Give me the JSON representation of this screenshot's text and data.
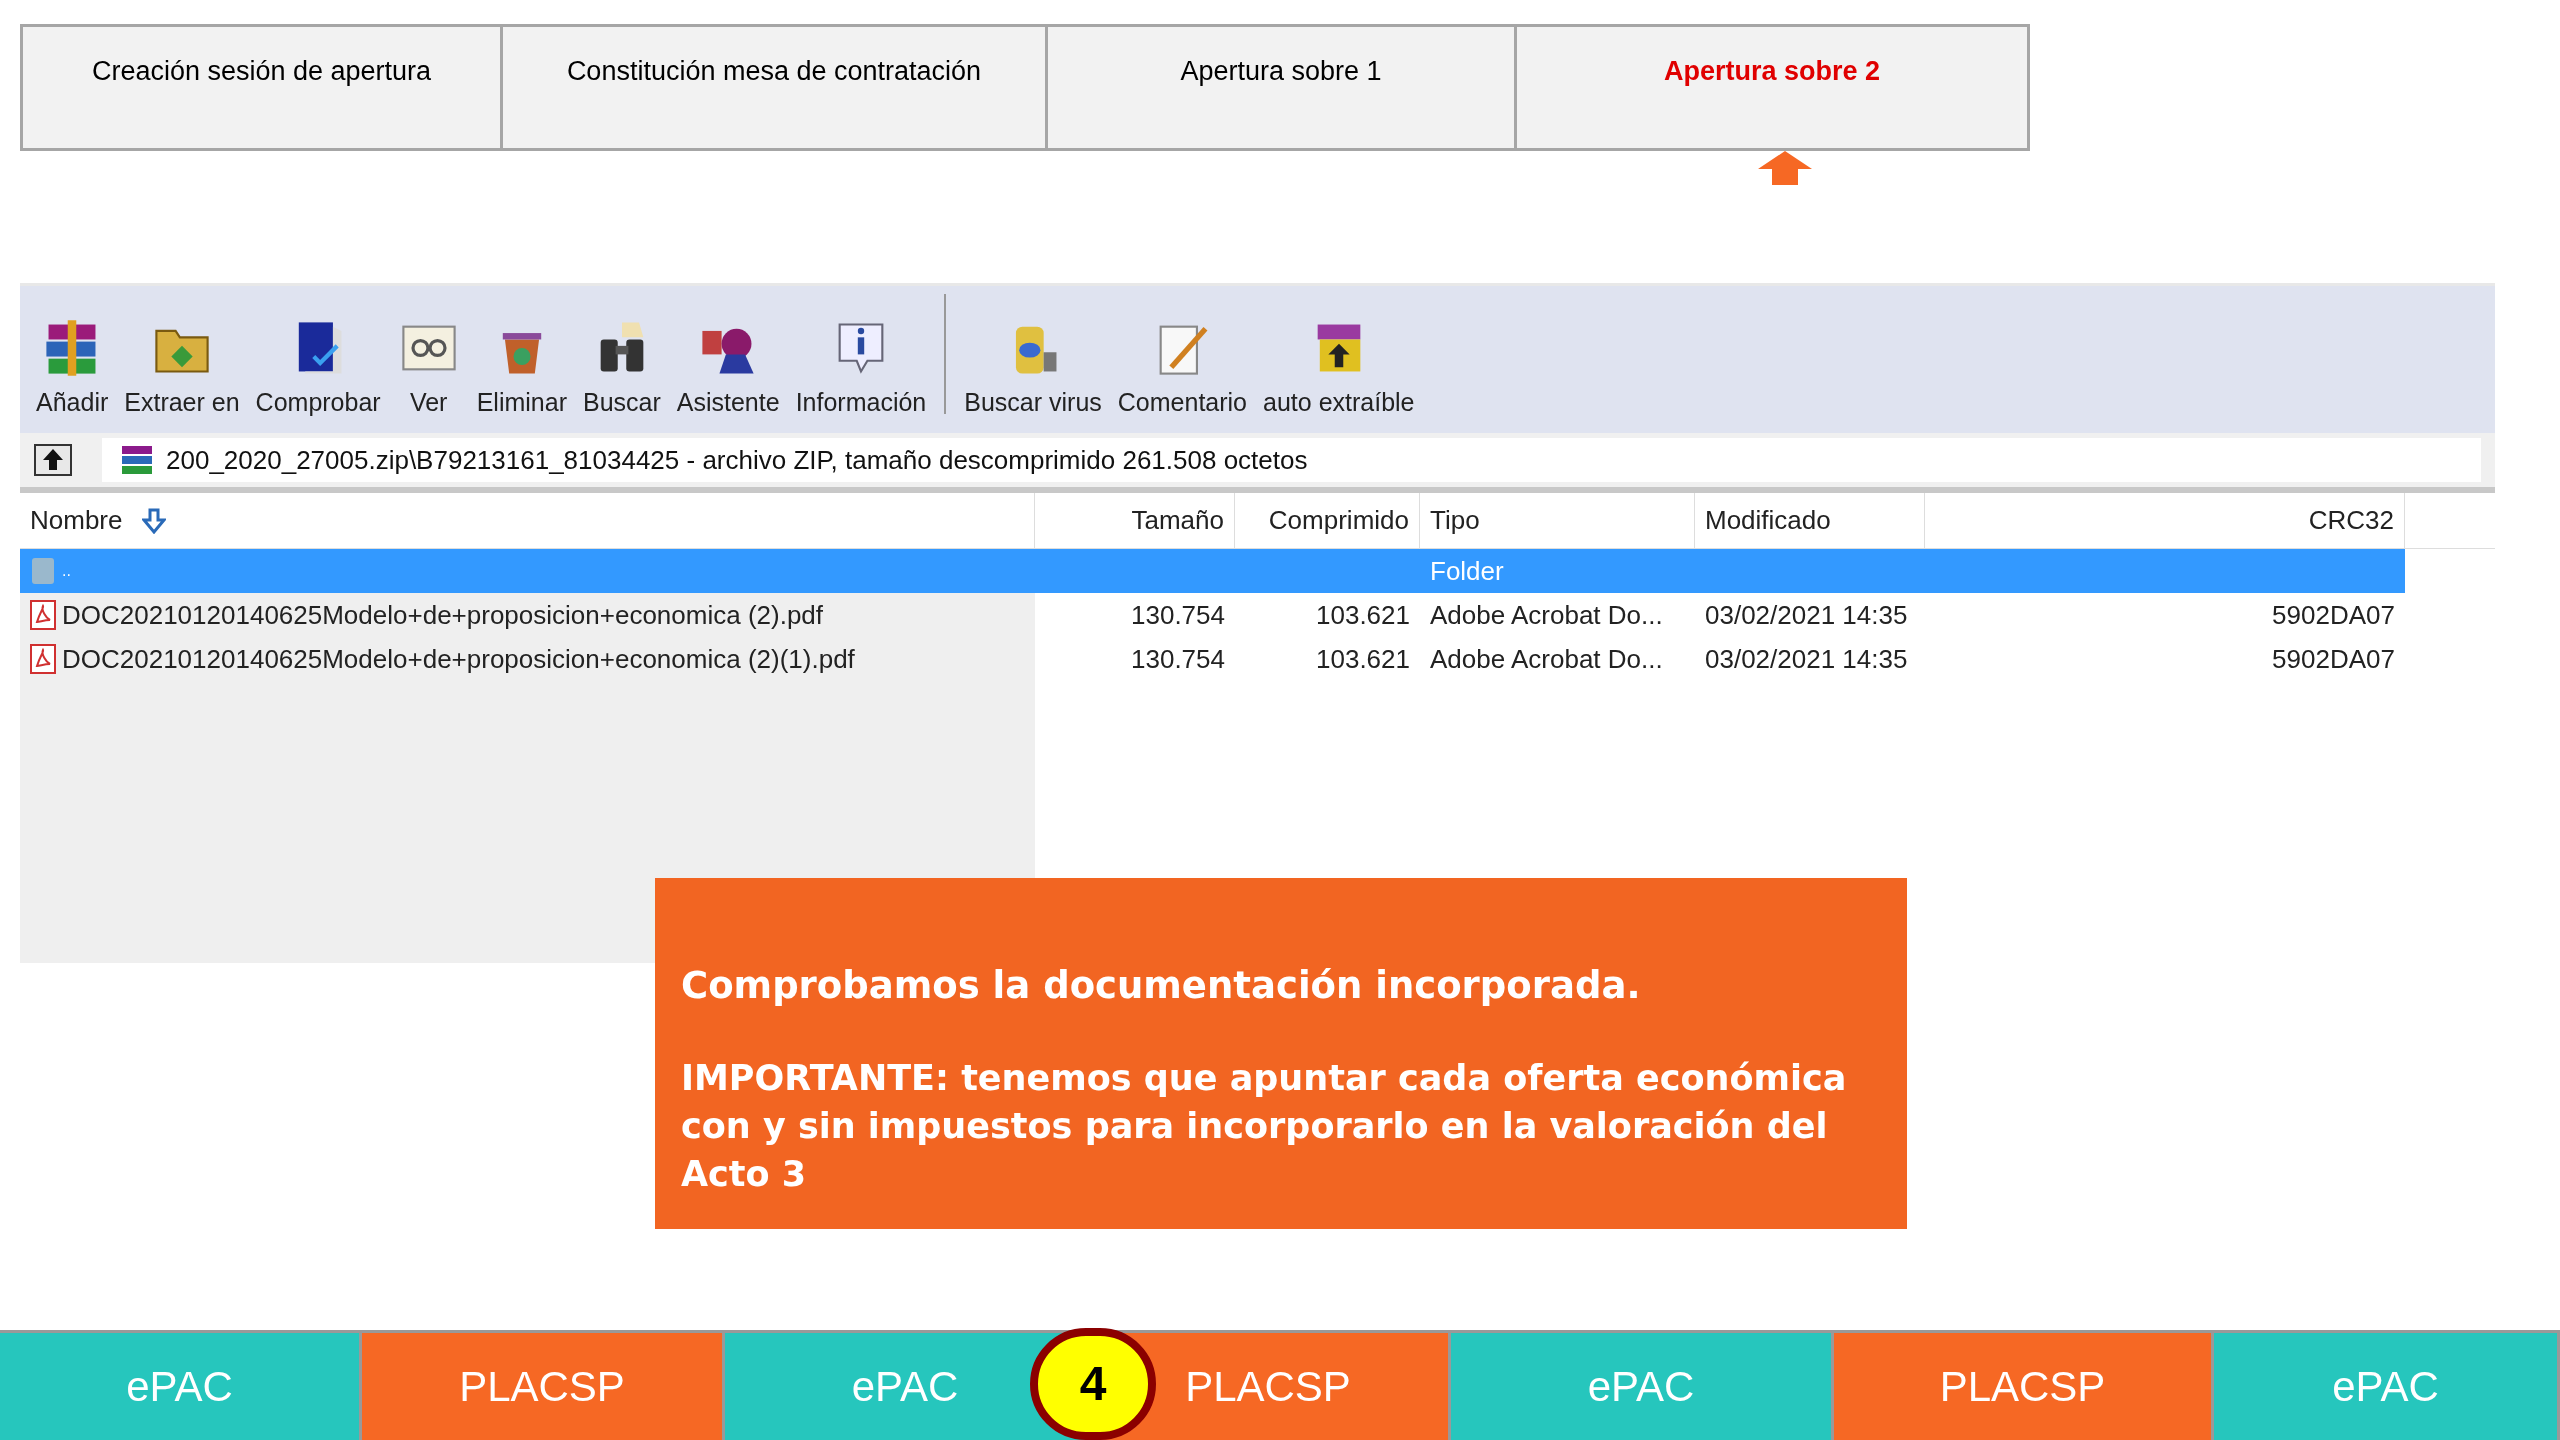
{
  "steps": [
    {
      "label": "Creación sesión de apertura",
      "selected": false
    },
    {
      "label": "Constitución mesa de contratación",
      "selected": false
    },
    {
      "label": "Apertura sobre 1",
      "selected": false
    },
    {
      "label": "Apertura sobre 2",
      "selected": true
    }
  ],
  "toolbar": [
    {
      "label": "Añadir",
      "kind": "books"
    },
    {
      "label": "Extraer en",
      "kind": "folder"
    },
    {
      "label": "Comprobar",
      "kind": "book"
    },
    {
      "label": "Ver",
      "kind": "glasses"
    },
    {
      "label": "Eliminar",
      "kind": "bin"
    },
    {
      "label": "Buscar",
      "kind": "binoculars"
    },
    {
      "label": "Asistente",
      "kind": "wizard"
    },
    {
      "label": "Información",
      "kind": "info"
    },
    {
      "label": "Buscar virus",
      "kind": "virus"
    },
    {
      "label": "Comentario",
      "kind": "note"
    },
    {
      "label": "auto extraíble",
      "kind": "sfx"
    }
  ],
  "path": "200_2020_27005.zip\\B79213161_81034425 - archivo ZIP, tamaño descomprimido 261.508 octetos",
  "columns": [
    "Nombre",
    "Tamaño",
    "Comprimido",
    "Tipo",
    "Modificado",
    "CRC32"
  ],
  "rows": [
    {
      "kind": "parent",
      "name": "..",
      "type": "Folder",
      "selected": true
    },
    {
      "kind": "pdf",
      "name": "DOC20210120140625Modelo+de+proposicion+economica (2).pdf",
      "size": "130.754",
      "packed": "103.621",
      "type": "Adobe Acrobat Do...",
      "modified": "03/02/2021 14:35",
      "crc": "5902DA07",
      "selected": false
    },
    {
      "kind": "pdf",
      "name": "DOC20210120140625Modelo+de+proposicion+economica (2)(1).pdf",
      "size": "130.754",
      "packed": "103.621",
      "type": "Adobe Acrobat Do...",
      "modified": "03/02/2021 14:35",
      "crc": "5902DA07",
      "selected": false
    }
  ],
  "note": [
    "Comprobamos la documentación incorporada.",
    "IMPORTANTE: tenemos que apuntar cada oferta económica con y sin impuestos para incorporarlo en la valoración del Acto 3"
  ],
  "bottom_bar": [
    {
      "label": "ePAC",
      "color": "#26c6bd"
    },
    {
      "label": "PLACSP",
      "color": "#f66824"
    },
    {
      "label": "ePAC",
      "color": "#26c6bd"
    },
    {
      "label": "PLACSP",
      "color": "#f66824"
    },
    {
      "label": "ePAC",
      "color": "#26c6bd"
    },
    {
      "label": "PLACSP",
      "color": "#f66824"
    },
    {
      "label": "ePAC",
      "color": "#26c6bd"
    }
  ],
  "step_badge": "4"
}
